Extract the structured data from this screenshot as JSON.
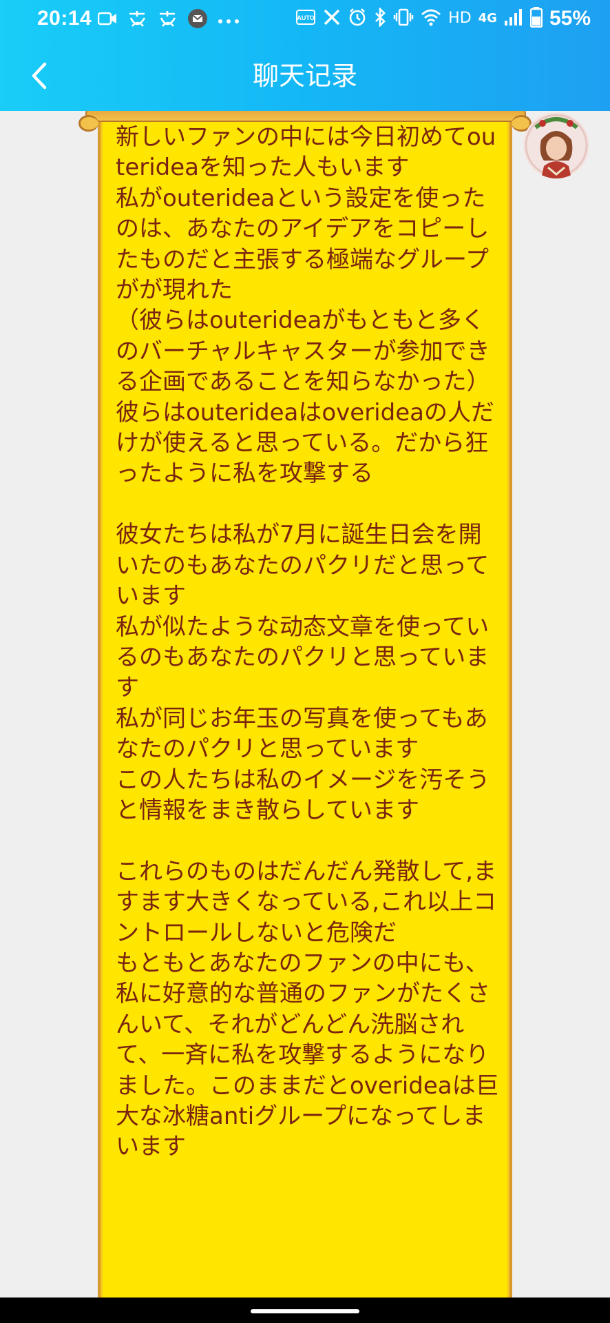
{
  "status_bar": {
    "time": "20:14",
    "network": "HD",
    "signal": "4G",
    "battery": "55%"
  },
  "header": {
    "title": "聊天记录",
    "back_icon": "chevron-left-icon"
  },
  "colors": {
    "header_gradient_start": "#19cdf8",
    "header_gradient_end": "#1ea0f2",
    "bubble_bg": "#ffe600",
    "bubble_text": "#7a2410",
    "bubble_border": "#d99a2b"
  },
  "message": {
    "text": "新しいファンの中には今日初めてouterideaを知った人もいます\n私がouterideaという設定を使ったのは、あなたのアイデアをコピーしたものだと主張する極端なグループがが現れた\n（彼らはouterideaがもともと多くのバーチャルキャスターが参加できる企画であることを知らなかった）\n彼らはouterideaはoverideaの人だけが使えると思っている。だから狂ったように私を攻撃する\n\n彼女たちは私が7月に誕生日会を開いたのもあなたのパクリだと思っています\n私が似たような动态文章を使っているのもあなたのパクリと思っています\n私が同じお年玉の写真を使ってもあなたのパクリと思っています\nこの人たちは私のイメージを汚そうと情報をまき散らしています\n\nこれらのものはだんだん発散して,ますます大きくなっている,これ以上コントロールしないと危険だ\nもともとあなたのファンの中にも、私に好意的な普通のファンがたくさんいて、それがどんどん洗脳されて、一斉に私を攻撃するようになりました。このままだとoverideaは巨大な冰糖antiグループになってしまいます"
  }
}
